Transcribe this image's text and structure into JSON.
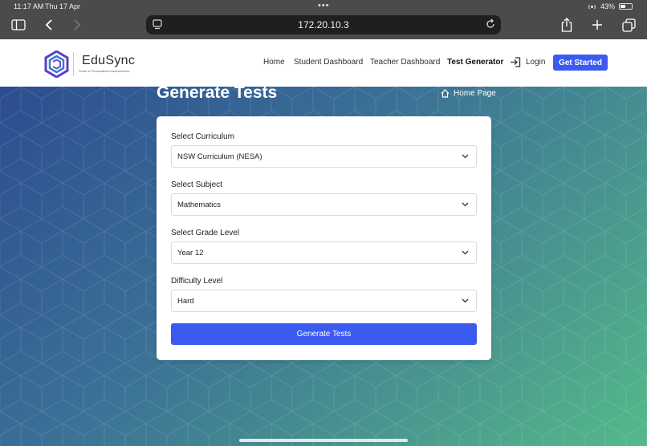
{
  "status_bar": {
    "time": "11:17 AM",
    "date": "Thu 17 Apr",
    "battery": "43%"
  },
  "browser": {
    "url": "172.20.10.3"
  },
  "navbar": {
    "brand_name": "EduSync",
    "brand_tagline": "Smart & Personalized Assessments",
    "links": [
      {
        "label": "Home"
      },
      {
        "label": "Student Dashboard"
      },
      {
        "label": "Teacher Dashboard"
      },
      {
        "label": "Test Generator"
      }
    ],
    "login_label": "Login",
    "cta_label": "Get Started"
  },
  "page": {
    "title": "Generate Tests",
    "home_link": "Home Page"
  },
  "form": {
    "fields": [
      {
        "label": "Select Curriculum",
        "value": "NSW Curriculum (NESA)"
      },
      {
        "label": "Select Subject",
        "value": "Mathematics"
      },
      {
        "label": "Select Grade Level",
        "value": "Year 12"
      },
      {
        "label": "Difficulty Level",
        "value": "Hard"
      }
    ],
    "submit_label": "Generate Tests"
  },
  "colors": {
    "primary": "#3b5bf0",
    "gradient_start": "#2c4d90",
    "gradient_end": "#54b98a"
  }
}
